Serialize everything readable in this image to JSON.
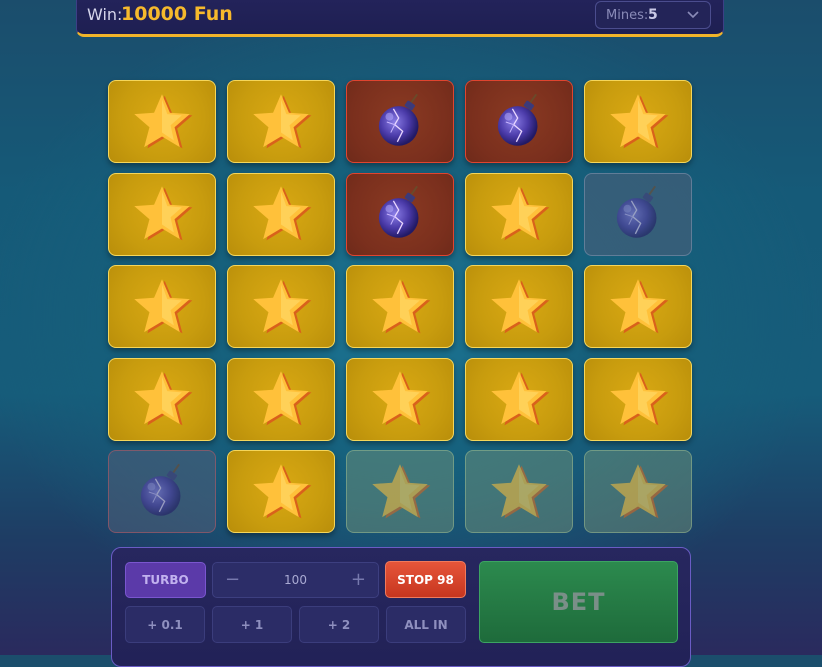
{
  "topbar": {
    "win_label": "Win:",
    "win_value": "10000 Fun",
    "mines_label": "Mines:",
    "mines_value": "5"
  },
  "colors": {
    "gem_tile": "#c89c0e",
    "bomb_tile": "#7a2f1d",
    "accent_gold": "#f6b92c",
    "bet_green": "#2c8a4e",
    "stop_red": "#d9452c",
    "turbo_purple": "#5b3aa9"
  },
  "grid": {
    "rows": 5,
    "cols": 5,
    "tiles": [
      "star",
      "star",
      "bomb-hit",
      "bomb-hit",
      "star",
      "star",
      "star",
      "bomb-hit",
      "star",
      "bomb-ghost",
      "star",
      "star",
      "star",
      "star",
      "star",
      "star",
      "star",
      "star",
      "star",
      "star",
      "bomb-ghost-red",
      "star",
      "star-ghost",
      "star-ghost",
      "star-ghost"
    ]
  },
  "controls": {
    "turbo_label": "TURBO",
    "amount": "100",
    "minus": "−",
    "plus": "+",
    "stop_label": "STOP 98",
    "inc_01": "+ 0.1",
    "inc_1": "+ 1",
    "inc_2": "+ 2",
    "allin_label": "ALL IN",
    "bet_label": "BET"
  }
}
